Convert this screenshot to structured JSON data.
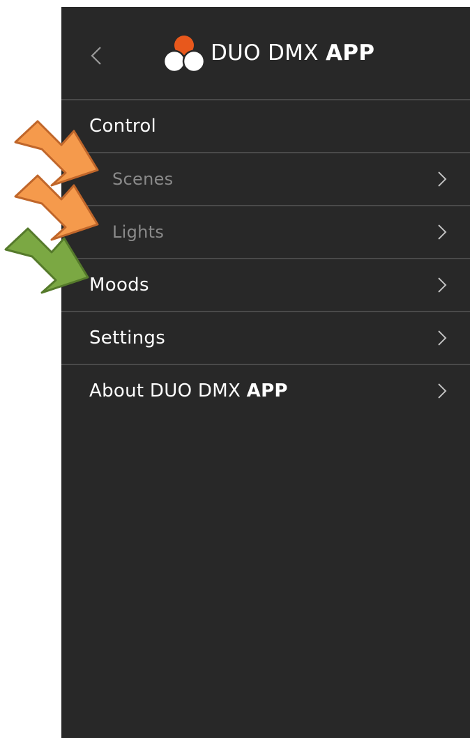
{
  "app": {
    "title_prefix": "DUO DMX ",
    "title_bold": "APP"
  },
  "header": {
    "back_icon": "chevron-left-icon",
    "logo_icon": "three-circles-logo-icon"
  },
  "menu": {
    "control": {
      "label": "Control"
    },
    "scenes": {
      "label": "Scenes"
    },
    "lights": {
      "label": "Lights"
    },
    "moods": {
      "label": "Moods"
    },
    "settings": {
      "label": "Settings"
    },
    "about": {
      "label_prefix": "About DUO DMX ",
      "label_bold": "APP"
    }
  },
  "annotations": {
    "arrow_colors": {
      "orange": "#F59A4C",
      "orange_border": "#C0662A",
      "green": "#7BA843",
      "green_border": "#557A2B"
    }
  },
  "colors": {
    "background": "#282828",
    "divider": "#4a4a4a",
    "accent": "#E8581C",
    "text": "#ffffff",
    "sub_text": "#8a8a8a"
  }
}
